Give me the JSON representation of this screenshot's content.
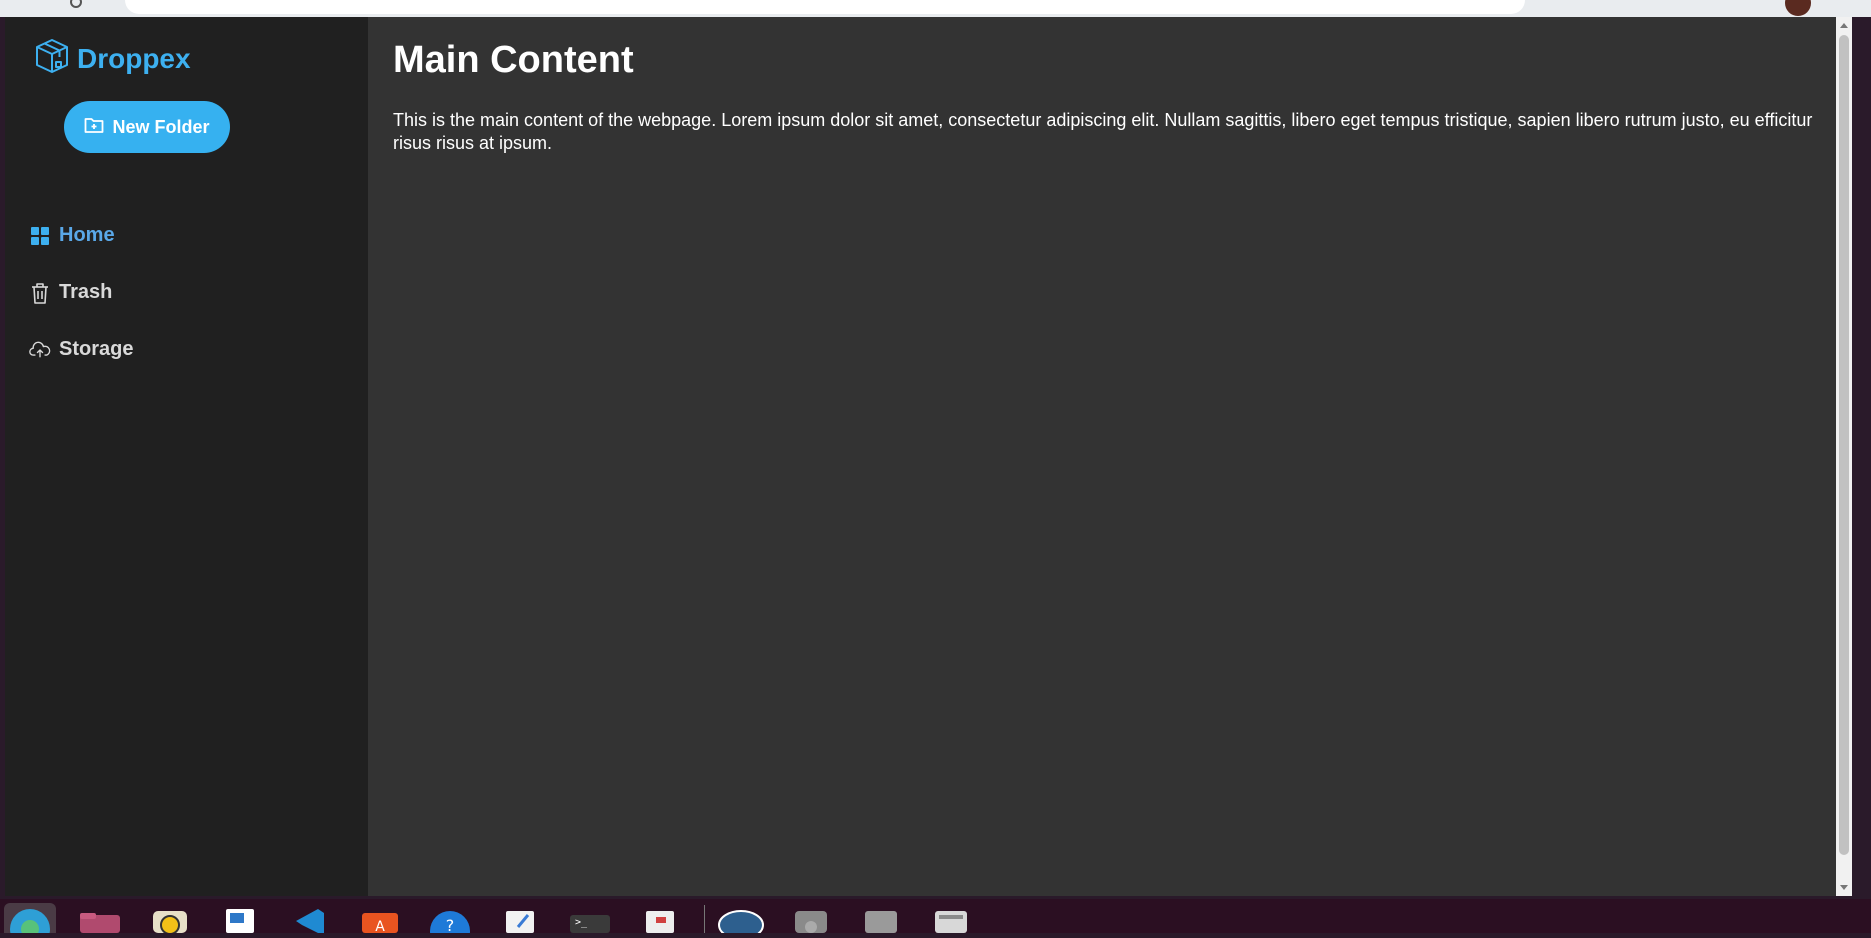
{
  "app": {
    "brand": "Droppex",
    "brand_color": "#3db0f0",
    "accent_color": "#36b1f0"
  },
  "sidebar": {
    "new_folder_label": "New Folder",
    "items": [
      {
        "label": "Home",
        "icon": "grid-icon",
        "active": true
      },
      {
        "label": "Trash",
        "icon": "trash-icon",
        "active": false
      },
      {
        "label": "Storage",
        "icon": "cloud-upload-icon",
        "active": false
      }
    ]
  },
  "main": {
    "title": "Main Content",
    "body": "This is the main content of the webpage. Lorem ipsum dolor sit amet, consectetur adipiscing elit. Nullam sagittis, libero eget tempus tristique, sapien libero rutrum justo, eu efficitur risus risus at ipsum."
  },
  "dock": {
    "apps": [
      "browser-icon",
      "files-icon",
      "rhythmbox-icon",
      "writer-icon",
      "vscode-icon",
      "app-center-icon",
      "help-icon",
      "text-editor-icon",
      "terminal-icon",
      "document-viewer-icon",
      "pgadmin-icon",
      "disk-icon",
      "drive-icon",
      "removable-drive-icon"
    ]
  }
}
